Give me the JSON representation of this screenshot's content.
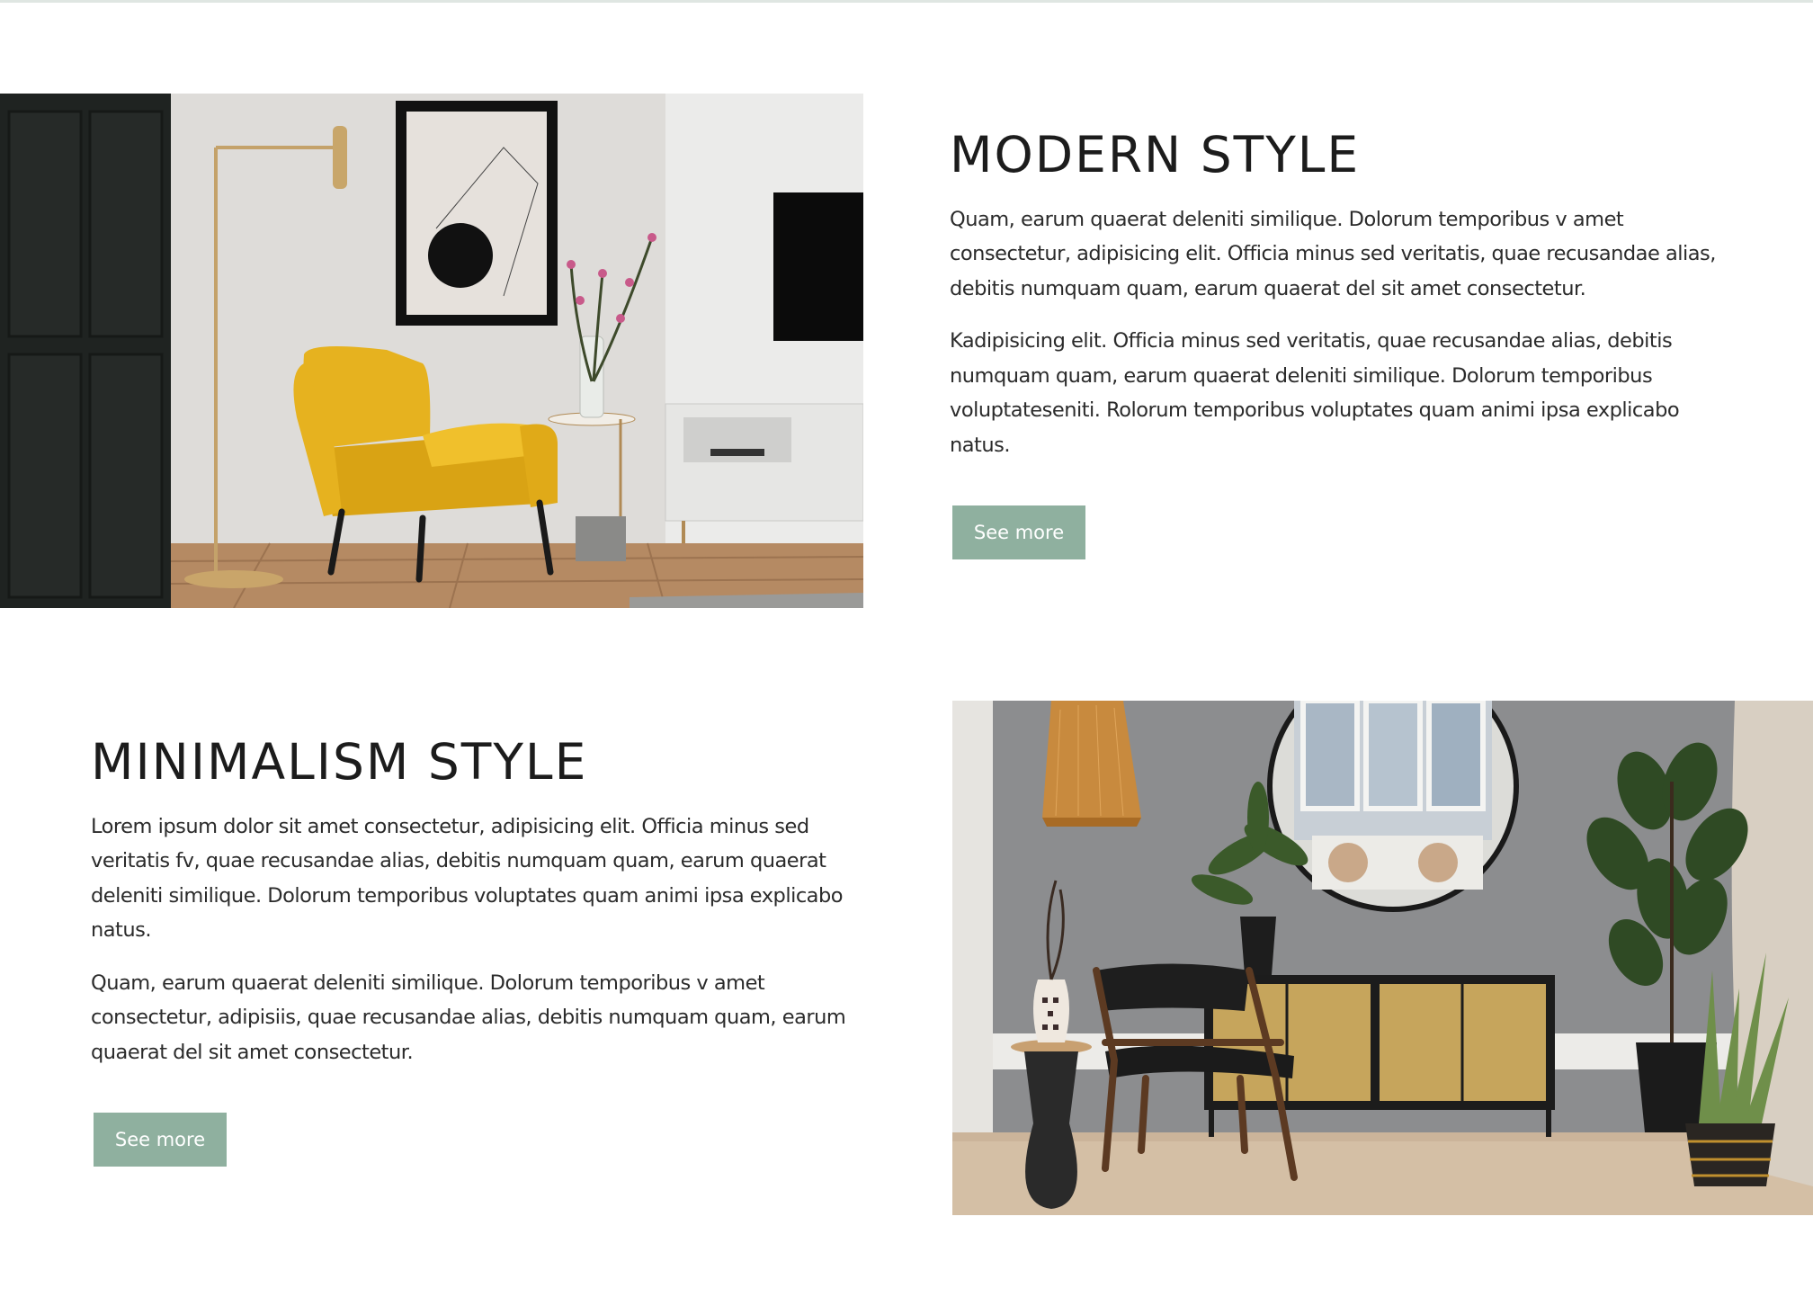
{
  "sections": [
    {
      "title": "MODERN STYLE",
      "paragraphs": [
        "Quam, earum quaerat deleniti similique. Dolorum temporibus v amet consectetur, adipisicing elit. Officia minus sed veritatis, quae recusandae alias, debitis numquam quam, earum quaerat del sit amet consectetur.",
        "Kadipisicing elit. Officia minus sed veritatis, quae recusandae alias, debitis numquam quam, earum quaerat deleniti similique. Dolorum temporibus voluptateseniti. Rolorum temporibus voluptates quam animi ipsa explicabo natus."
      ],
      "button_label": "See more"
    },
    {
      "title": "MINIMALISM STYLE",
      "paragraphs": [
        "Lorem ipsum dolor sit amet consectetur, adipisicing elit. Officia minus sed veritatis fv, quae recusandae alias, debitis numquam quam, earum quaerat deleniti similique. Dolorum temporibus voluptates quam animi ipsa explicabo natus.",
        "Quam, earum quaerat deleniti similique. Dolorum temporibus v amet consectetur, adipisiis, quae recusandae alias, debitis numquam quam, earum quaerat del sit amet consectetur."
      ],
      "button_label": "See more"
    }
  ],
  "colors": {
    "button_bg": "#8fb09f",
    "button_text": "#ffffff",
    "title": "#1c1c1c",
    "body_text": "#2b2b2b"
  }
}
